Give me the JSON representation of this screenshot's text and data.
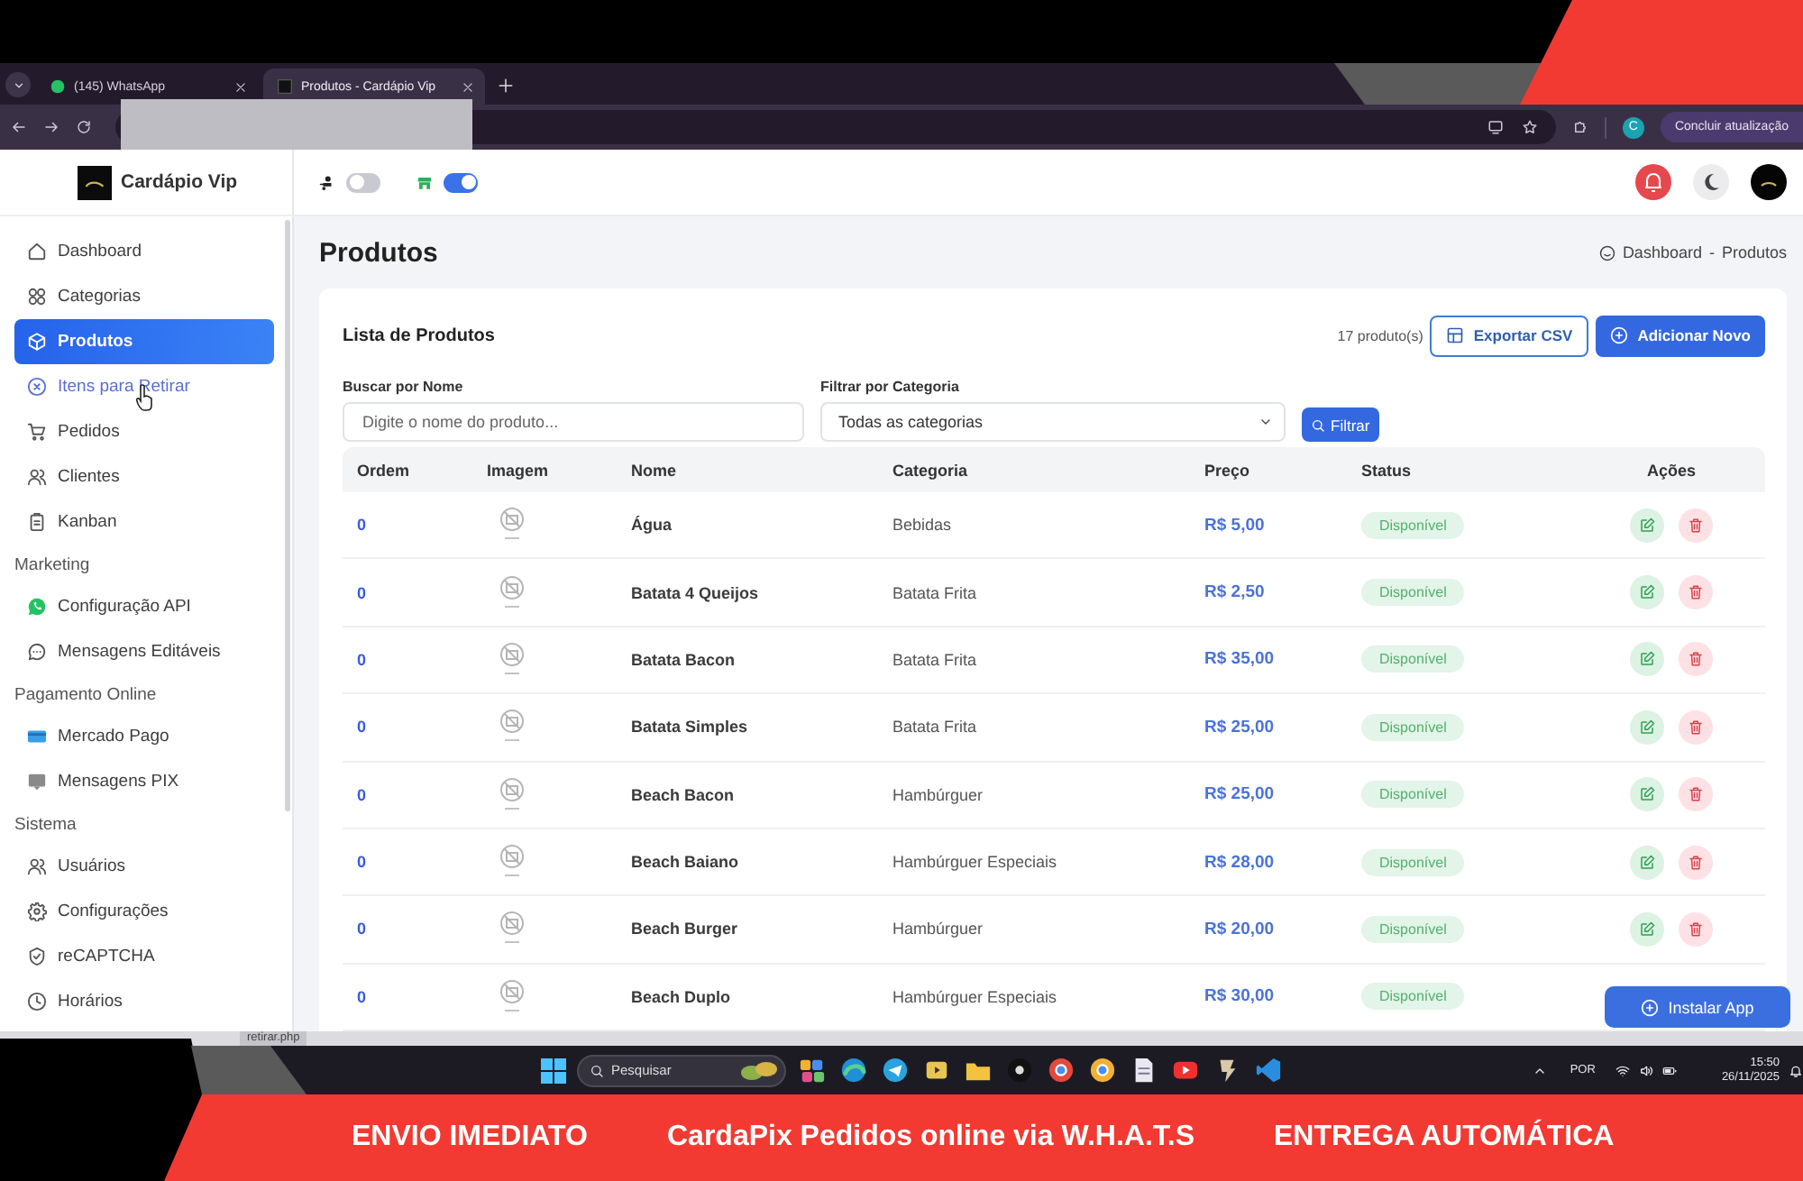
{
  "browser": {
    "tabs": [
      {
        "title": "(145) WhatsApp",
        "selected": false
      },
      {
        "title": "Produtos - Cardápio Vip",
        "selected": true
      }
    ],
    "profile_initial": "C",
    "update_button": "Concluir atualização"
  },
  "app": {
    "brand": "Cardápio Vip",
    "header_toggles": [
      {
        "on": false
      },
      {
        "on": true
      }
    ],
    "sidebar": [
      {
        "items": [
          {
            "label": "Dashboard",
            "selected": false,
            "hovered": false
          },
          {
            "label": "Categorias",
            "selected": false,
            "hovered": false
          },
          {
            "label": "Produtos",
            "selected": true,
            "hovered": false
          },
          {
            "label": "Itens para Retirar",
            "selected": false,
            "hovered": true
          },
          {
            "label": "Pedidos",
            "selected": false,
            "hovered": false
          },
          {
            "label": "Clientes",
            "selected": false,
            "hovered": false
          },
          {
            "label": "Kanban",
            "selected": false,
            "hovered": false
          }
        ]
      },
      {
        "title": "Marketing",
        "items": [
          {
            "label": "Configuração API",
            "selected": false,
            "hovered": false
          },
          {
            "label": "Mensagens Editáveis",
            "selected": false,
            "hovered": false
          }
        ]
      },
      {
        "title": "Pagamento Online",
        "items": [
          {
            "label": "Mercado Pago",
            "selected": false,
            "hovered": false
          },
          {
            "label": "Mensagens PIX",
            "selected": false,
            "hovered": false
          }
        ]
      },
      {
        "title": "Sistema",
        "items": [
          {
            "label": "Usuários",
            "selected": false,
            "hovered": false
          },
          {
            "label": "Configurações",
            "selected": false,
            "hovered": false
          },
          {
            "label": "reCAPTCHA",
            "selected": false,
            "hovered": false
          },
          {
            "label": "Horários",
            "selected": false,
            "hovered": false
          }
        ]
      }
    ],
    "page_title": "Produtos",
    "breadcrumb": {
      "items": [
        "Dashboard",
        "Produtos"
      ],
      "separator": "-"
    },
    "list": {
      "title": "Lista de Produtos",
      "count": "17 produto(s)",
      "export_button": "Exportar CSV",
      "add_button": "Adicionar Novo",
      "search": {
        "label": "Buscar por Nome",
        "placeholder": "Digite o nome do produto..."
      },
      "category_filter": {
        "label": "Filtrar por Categoria",
        "value": "Todas as categorias"
      },
      "filter_button": "Filtrar"
    },
    "table": {
      "columns": [
        "Ordem",
        "Imagem",
        "Nome",
        "Categoria",
        "Preço",
        "Status",
        "Ações"
      ],
      "rows": [
        {
          "order": "0",
          "name": "Água",
          "category": "Bebidas",
          "price": "R$ 5,00",
          "status": "Disponível",
          "show_actions": true
        },
        {
          "order": "0",
          "name": "Batata 4 Queijos",
          "category": "Batata Frita",
          "price": "R$ 2,50",
          "status": "Disponível",
          "show_actions": true
        },
        {
          "order": "0",
          "name": "Batata Bacon",
          "category": "Batata Frita",
          "price": "R$ 35,00",
          "status": "Disponível",
          "show_actions": true
        },
        {
          "order": "0",
          "name": "Batata Simples",
          "category": "Batata Frita",
          "price": "R$ 25,00",
          "status": "Disponível",
          "show_actions": true
        },
        {
          "order": "0",
          "name": "Beach Bacon",
          "category": "Hambúrguer",
          "price": "R$ 25,00",
          "status": "Disponível",
          "show_actions": true
        },
        {
          "order": "0",
          "name": "Beach Baiano",
          "category": "Hambúrguer Especiais",
          "price": "R$ 28,00",
          "status": "Disponível",
          "show_actions": true
        },
        {
          "order": "0",
          "name": "Beach Burger",
          "category": "Hambúrguer",
          "price": "R$ 20,00",
          "status": "Disponível",
          "show_actions": true
        },
        {
          "order": "0",
          "name": "Beach Duplo",
          "category": "Hambúrguer Especiais",
          "price": "R$ 30,00",
          "status": "Disponível",
          "show_actions": false
        }
      ]
    },
    "install_button": "Instalar App"
  },
  "status_url": "retirar.php",
  "taskbar": {
    "search_placeholder": "Pesquisar",
    "language": "POR",
    "time": "15:50",
    "date": "26/11/2025"
  },
  "banner": [
    "ENVIO IMEDIATO",
    "CardaPix Pedidos online via W.H.A.T.S",
    "ENTREGA AUTOMÁTICA"
  ]
}
